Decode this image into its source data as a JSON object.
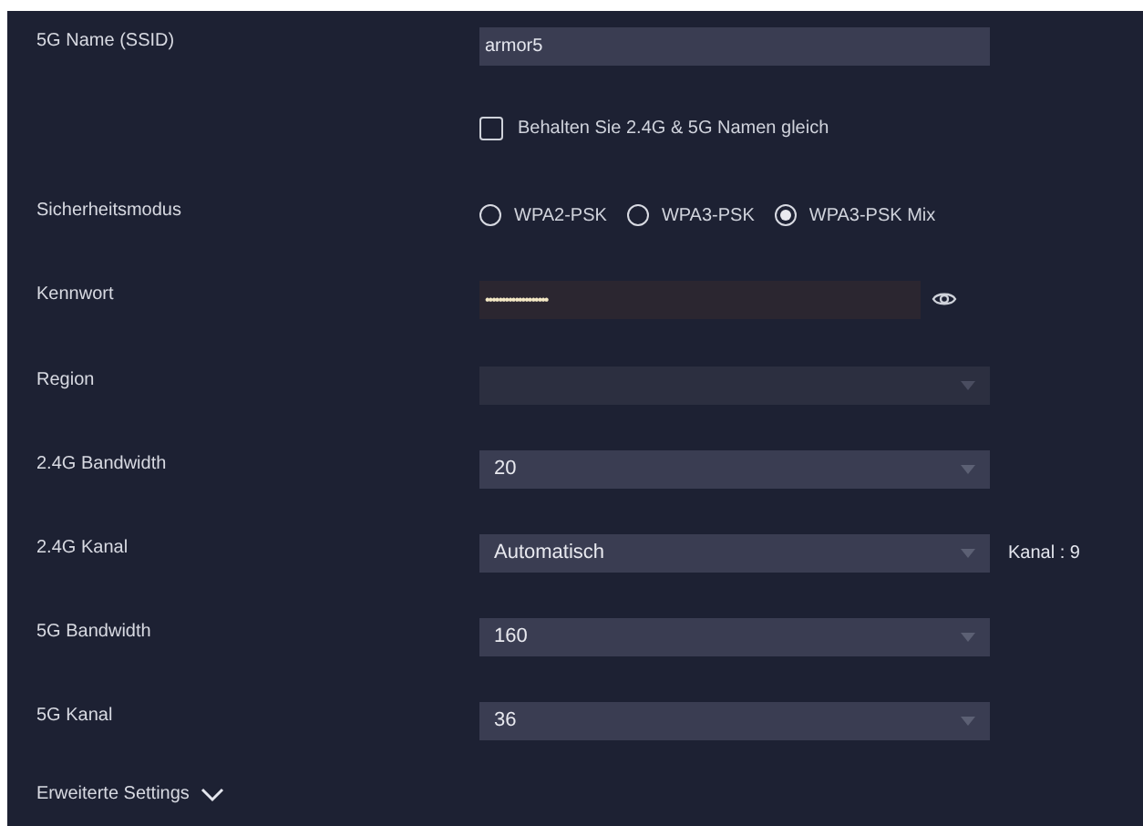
{
  "rows": [
    {
      "kind": "text",
      "label": "5G Name (SSID)",
      "value": "armor5"
    },
    {
      "kind": "checkbox",
      "text": "Behalten Sie 2.4G & 5G Namen gleich",
      "checked": false
    },
    {
      "kind": "radio",
      "label": "Sicherheitsmodus",
      "options": [
        {
          "label": "WPA2-PSK",
          "selected": false
        },
        {
          "label": "WPA3-PSK",
          "selected": false
        },
        {
          "label": "WPA3-PSK Mix",
          "selected": true
        }
      ]
    },
    {
      "kind": "password",
      "label": "Kennwort",
      "value": "•••••••••••••••••••"
    },
    {
      "kind": "select",
      "label": "Region",
      "disabled": true
    },
    {
      "kind": "select",
      "label": "2.4G Bandwidth",
      "value": "20",
      "disabled": false
    },
    {
      "kind": "select",
      "label": "2.4G Kanal",
      "value": "Automatisch",
      "disabled": false,
      "note": "Kanal : 9"
    },
    {
      "kind": "select",
      "label": "5G Bandwidth",
      "value": "160",
      "disabled": false
    },
    {
      "kind": "select",
      "label": "5G Kanal",
      "value": "36",
      "disabled": false
    }
  ],
  "advanced": {
    "label": "Erweiterte Settings",
    "expanded": false
  }
}
